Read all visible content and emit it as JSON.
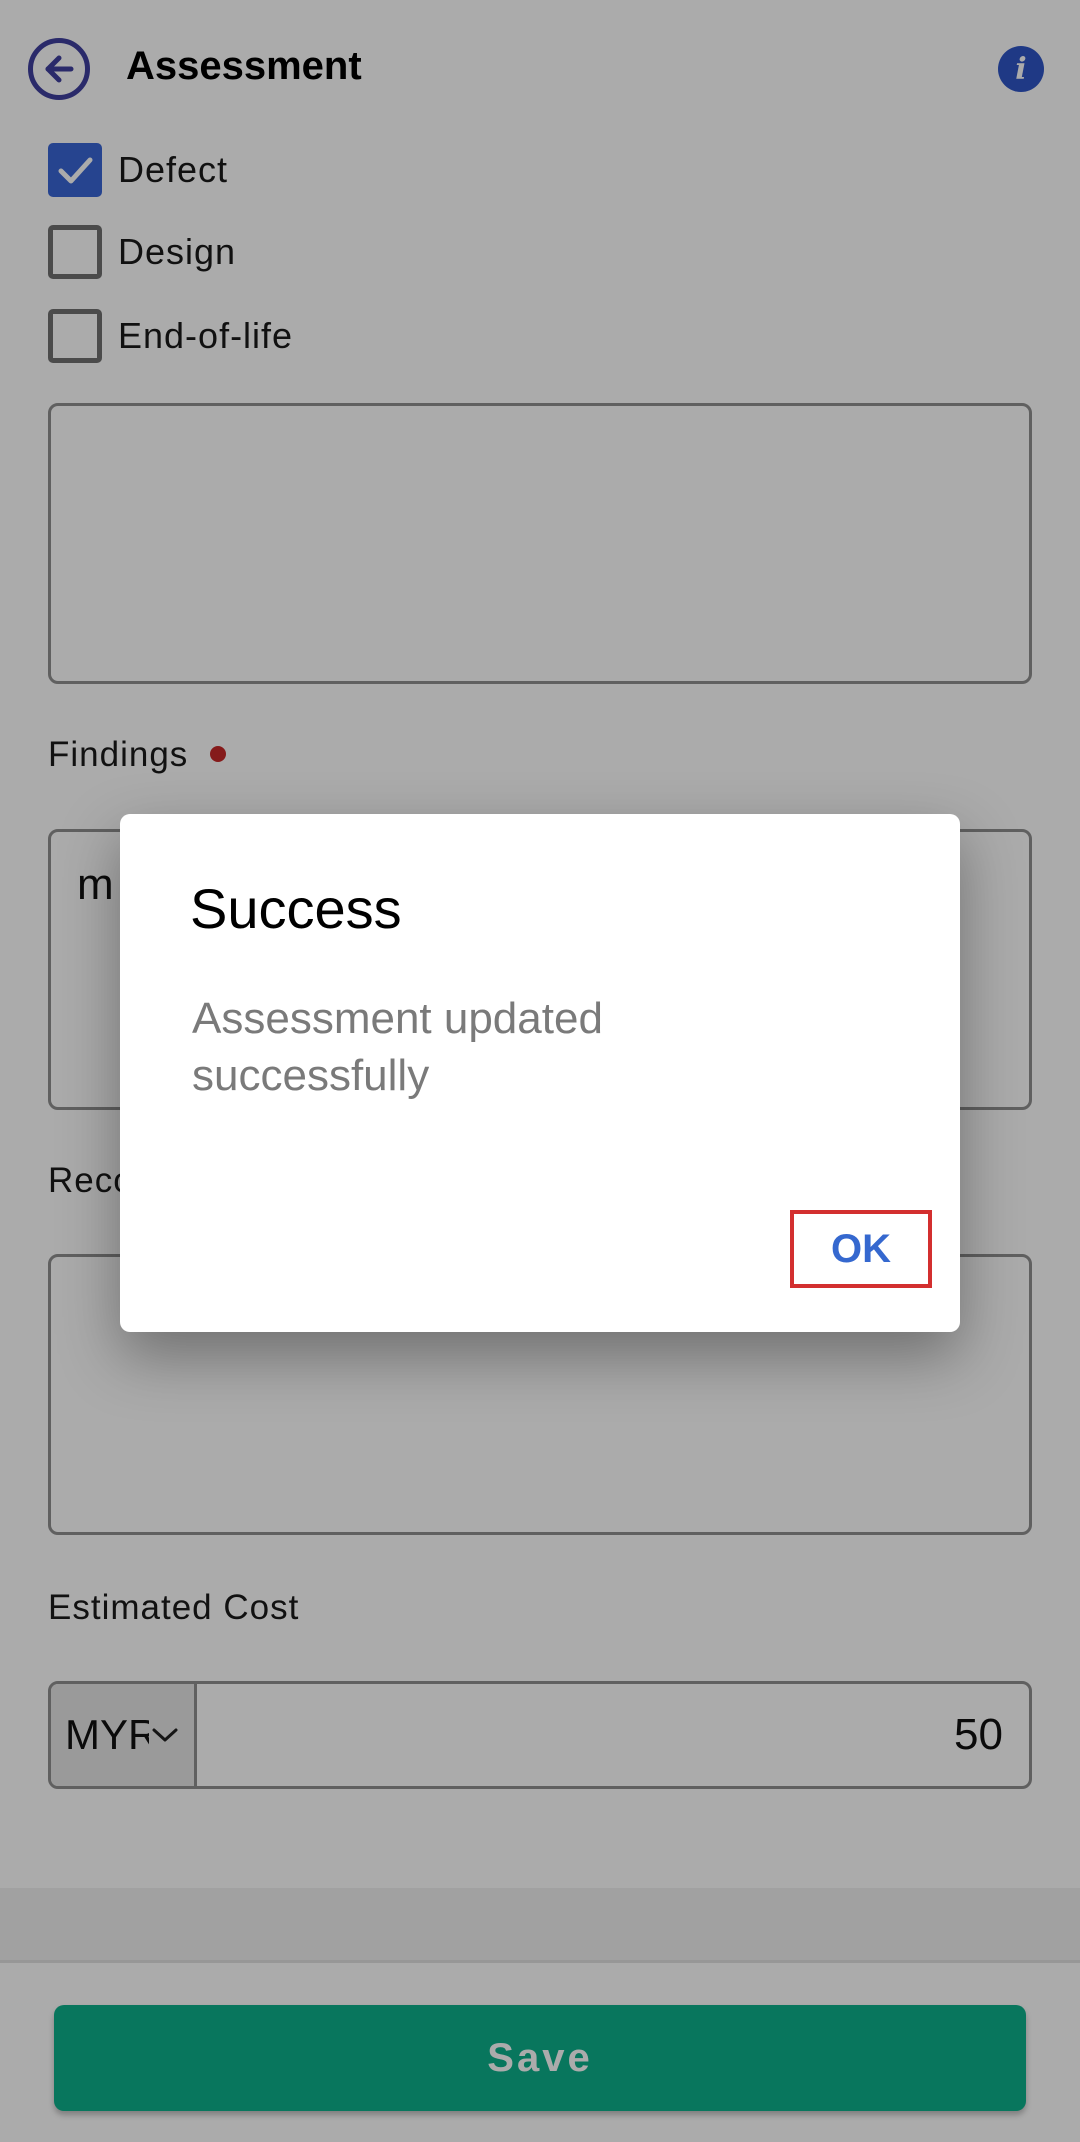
{
  "header": {
    "title": "Assessment",
    "info_icon_glyph": "i",
    "back_icon": "arrow-left-circle-icon",
    "accent_color": "#3f3f9f"
  },
  "categories": [
    {
      "label": "Defect",
      "checked": true
    },
    {
      "label": "Design",
      "checked": false
    },
    {
      "label": "End-of-life",
      "checked": false
    }
  ],
  "notes_field": {
    "value": ""
  },
  "findings": {
    "label": "Findings",
    "required": true,
    "value": "m"
  },
  "recommendation": {
    "label": "Reco",
    "value": ""
  },
  "estimated_cost": {
    "label": "Estimated Cost",
    "currency": "MYR",
    "amount": "50"
  },
  "footer": {
    "save_label": "Save",
    "save_color": "#0db08b"
  },
  "dialog": {
    "title": "Success",
    "message": "Assessment updated successfully",
    "ok_label": "OK",
    "ok_color": "#3568cf"
  }
}
